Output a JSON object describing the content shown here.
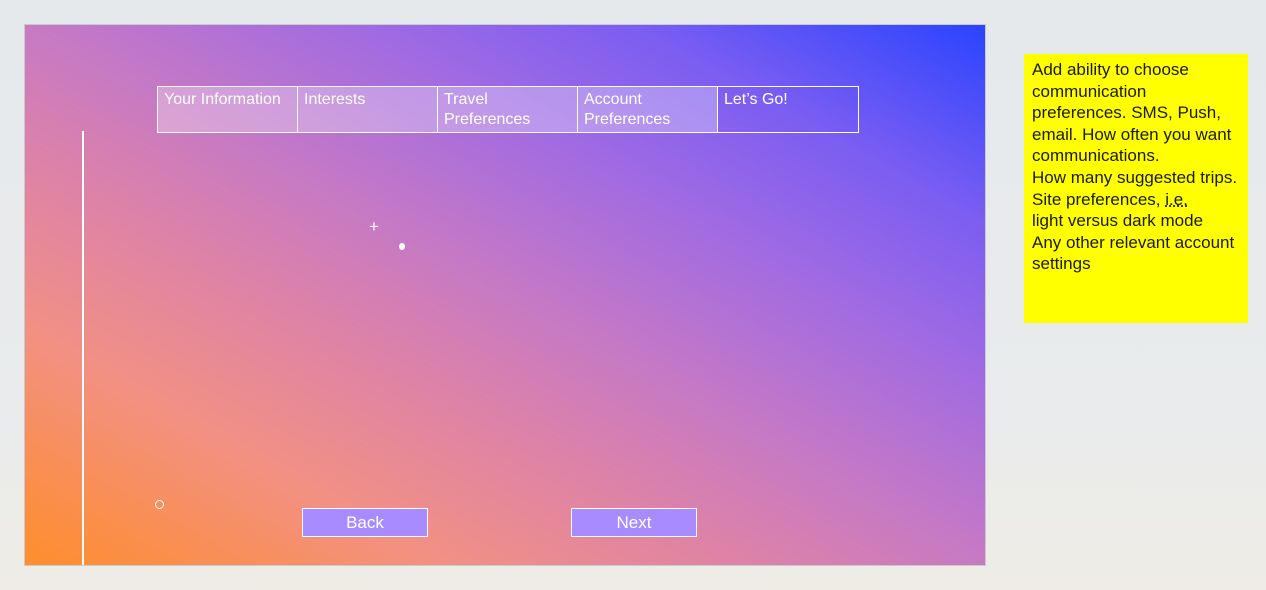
{
  "tabs": [
    {
      "label": "Your Information"
    },
    {
      "label": "Interests"
    },
    {
      "label": "Travel Preferences"
    },
    {
      "label": "Account Preferences"
    },
    {
      "label": "Let’s Go!"
    }
  ],
  "canvas": {
    "plus_glyph": "+"
  },
  "buttons": {
    "back": "Back",
    "next": "Next"
  },
  "sticky_note": {
    "line1": "Add ability to choose communication preferences.  SMS, Push, email.  How often you want communications.",
    "line2": "How many suggested trips.",
    "line3_before": "Site preferences, ",
    "line3_underlined": "i.e.",
    "line4": "light versus dark mode",
    "line5": "Any other relevant account settings"
  },
  "colors": {
    "gradient_bottom_left": "#ff8e2c",
    "gradient_top_right": "#2a44fe",
    "button_fill": "#a88cff",
    "note_fill": "#ffff00"
  }
}
